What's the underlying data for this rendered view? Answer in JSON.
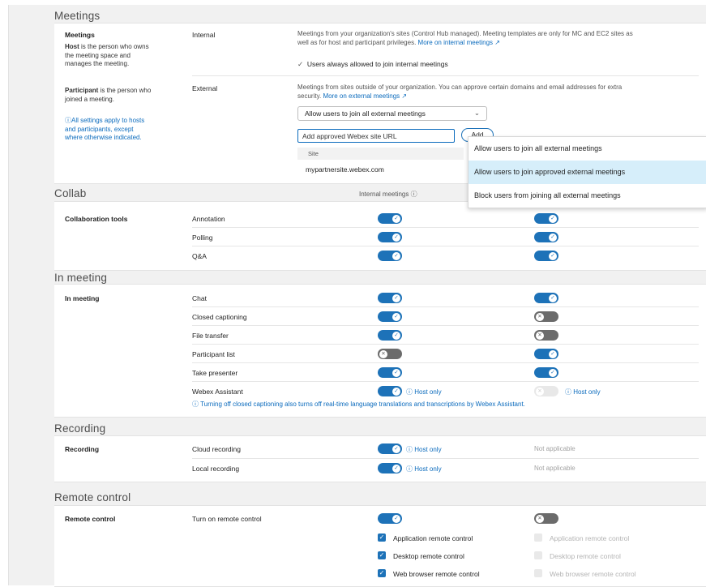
{
  "meetings": {
    "title": "Meetings",
    "left": {
      "heading": "Meetings",
      "host_bold": "Host",
      "host_text": " is the person who owns the meeting space and manages the meeting.",
      "participant_bold": "Participant",
      "participant_text": " is the person who joined a meeting.",
      "info_note": "All settings apply to hosts and participants, except where otherwise indicated."
    },
    "internal": {
      "label": "Internal",
      "desc": "Meetings from your organization's sites (Control Hub managed). Meeting templates are only for MC and EC2 sites as well as for host and participant privileges.",
      "link": "More on internal meetings",
      "check_text": "Users always allowed to join internal meetings"
    },
    "external": {
      "label": "External",
      "desc": "Meetings from sites outside of your organization. You can approve certain domains and email addresses for extra security.",
      "link": "More on external meetings",
      "select_value": "Allow users to join all external meetings",
      "input_placeholder": "Add approved Webex site URL",
      "add_button": "Add",
      "table_header": "Site",
      "site_row": "mypartnersite.webex.com"
    },
    "dropdown_options": [
      "Allow users to join all external meetings",
      "Allow users to join approved external meetings",
      "Block users from joining all external meetings"
    ]
  },
  "collab": {
    "title": "Collab",
    "column_internal": "Internal meetings",
    "row_heading": "Collaboration tools",
    "items": [
      {
        "label": "Annotation",
        "internal": "on",
        "external": "on"
      },
      {
        "label": "Polling",
        "internal": "on",
        "external": "on"
      },
      {
        "label": "Q&A",
        "internal": "on",
        "external": "on"
      }
    ]
  },
  "in_meeting": {
    "title": "In meeting",
    "row_heading": "In meeting",
    "items": [
      {
        "label": "Chat",
        "internal": "on",
        "external": "on"
      },
      {
        "label": "Closed captioning",
        "internal": "on",
        "external": "off"
      },
      {
        "label": "File transfer",
        "internal": "on",
        "external": "off"
      },
      {
        "label": "Participant list",
        "internal": "off",
        "external": "on"
      },
      {
        "label": "Take presenter",
        "internal": "on",
        "external": "on"
      },
      {
        "label": "Webex Assistant",
        "internal": "on",
        "external": "disabled"
      }
    ],
    "host_only": "Host only",
    "note": "Turning off closed captioning also turns off real-time language translations and transcriptions by Webex Assistant."
  },
  "recording": {
    "title": "Recording",
    "row_heading": "Recording",
    "items": [
      {
        "label": "Cloud recording"
      },
      {
        "label": "Local recording"
      }
    ],
    "host_only": "Host only",
    "not_applicable": "Not applicable"
  },
  "remote_control": {
    "title": "Remote control",
    "row_heading": "Remote control",
    "toggle_label": "Turn on remote control",
    "options": [
      "Application remote control",
      "Desktop remote control",
      "Web browser remote control"
    ]
  },
  "colors": {
    "accent": "#1d72b8",
    "link": "#0b6bbd",
    "toggle_off": "#6b6b6b",
    "menu_selected": "#d6eefa",
    "section_bg": "#f1f1f1"
  },
  "icons": [
    "info-icon",
    "external-link-icon",
    "check-icon",
    "chevron-down-icon",
    "x-icon"
  ]
}
